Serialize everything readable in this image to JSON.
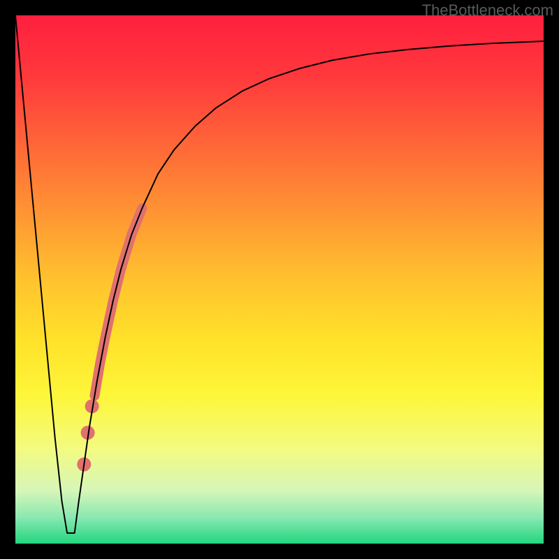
{
  "watermark": "TheBottleneck.com",
  "chart_data": {
    "type": "line",
    "title": "",
    "xlabel": "",
    "ylabel": "",
    "xlim": [
      0,
      100
    ],
    "ylim": [
      0,
      100
    ],
    "background_gradient_stops": [
      {
        "offset": 0.0,
        "color": "#ff1f3e"
      },
      {
        "offset": 0.12,
        "color": "#ff3a3c"
      },
      {
        "offset": 0.3,
        "color": "#ff7a36"
      },
      {
        "offset": 0.5,
        "color": "#ffc22e"
      },
      {
        "offset": 0.62,
        "color": "#ffe32a"
      },
      {
        "offset": 0.72,
        "color": "#fdf63a"
      },
      {
        "offset": 0.82,
        "color": "#f3fb80"
      },
      {
        "offset": 0.9,
        "color": "#d6f6b8"
      },
      {
        "offset": 0.95,
        "color": "#8be8b2"
      },
      {
        "offset": 1.0,
        "color": "#22d67f"
      }
    ],
    "series": [
      {
        "name": "bottleneck-curve",
        "color": "#000000",
        "stroke_width": 2,
        "x": [
          0.0,
          1.5,
          3.0,
          4.5,
          6.0,
          7.5,
          8.8,
          9.8,
          10.4,
          11.2,
          12.0,
          13.0,
          14.0,
          15.5,
          17.0,
          18.5,
          20.0,
          22.0,
          24.0,
          27.0,
          30.0,
          34.0,
          38.0,
          43.0,
          48.0,
          54.0,
          60.0,
          67.0,
          74.0,
          82.0,
          90.0,
          100.0
        ],
        "y": [
          100.0,
          84.0,
          68.0,
          52.0,
          36.0,
          20.0,
          8.0,
          2.0,
          2.0,
          2.0,
          8.0,
          15.0,
          22.0,
          31.0,
          39.0,
          46.0,
          52.0,
          58.5,
          63.5,
          70.0,
          74.5,
          79.0,
          82.5,
          85.7,
          88.0,
          90.0,
          91.5,
          92.7,
          93.5,
          94.2,
          94.7,
          95.1
        ]
      }
    ],
    "highlight_segment": {
      "name": "highlighted-range",
      "color": "#e0716e",
      "x": [
        15.0,
        16.0,
        17.0,
        18.5,
        20.0,
        22.0,
        24.0
      ],
      "y": [
        28.0,
        34.0,
        39.0,
        46.0,
        52.0,
        58.5,
        63.5
      ],
      "stroke_width": 14
    },
    "highlight_points": {
      "name": "highlighted-dots",
      "color": "#e0716e",
      "radius": 10,
      "points": [
        {
          "x": 13.0,
          "y": 15.0
        },
        {
          "x": 13.7,
          "y": 21.0
        },
        {
          "x": 14.5,
          "y": 26.0
        }
      ]
    }
  }
}
